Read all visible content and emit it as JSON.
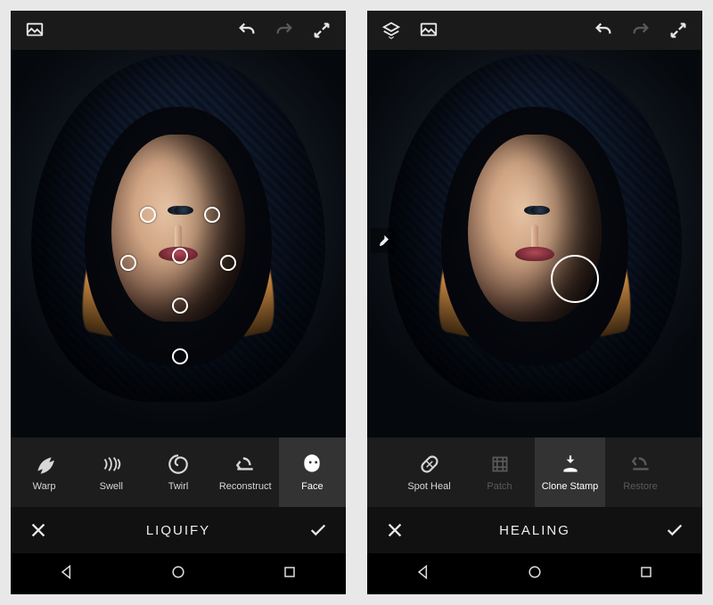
{
  "left": {
    "title": "LIQUIFY",
    "tools": [
      {
        "label": "Warp",
        "selected": false,
        "disabled": false
      },
      {
        "label": "Swell",
        "selected": false,
        "disabled": false
      },
      {
        "label": "Twirl",
        "selected": false,
        "disabled": false
      },
      {
        "label": "Reconstruct",
        "selected": false,
        "disabled": false
      },
      {
        "label": "Face",
        "selected": true,
        "disabled": false
      }
    ]
  },
  "right": {
    "title": "HEALING",
    "tools": [
      {
        "label": "Spot Heal",
        "selected": false,
        "disabled": false
      },
      {
        "label": "Patch",
        "selected": false,
        "disabled": true
      },
      {
        "label": "Clone Stamp",
        "selected": true,
        "disabled": false
      },
      {
        "label": "Restore",
        "selected": false,
        "disabled": true
      }
    ]
  }
}
